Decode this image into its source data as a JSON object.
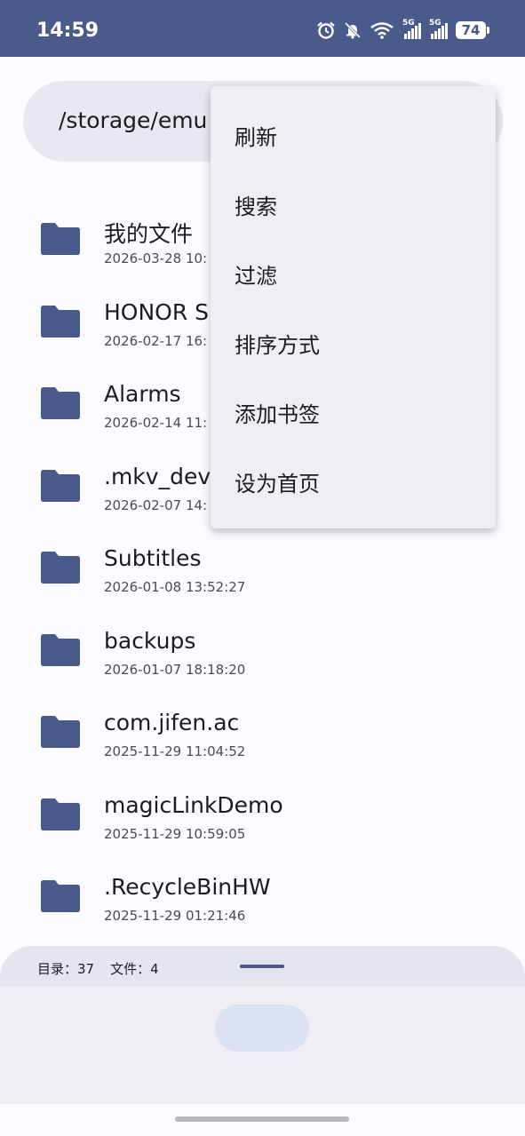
{
  "status_bar": {
    "time": "14:59",
    "signal1_label": "5G",
    "signal2_label": "5G",
    "battery": "74",
    "icons": [
      "alarm-icon",
      "bell-muted-icon",
      "wifi-icon",
      "signal-icon",
      "signal-icon",
      "battery-icon"
    ]
  },
  "path_bar": {
    "path": "/storage/emu"
  },
  "files": [
    {
      "name": " 我的文件",
      "date": "2026-03-28 10:"
    },
    {
      "name": "HONOR S",
      "date": "2026-02-17 16:"
    },
    {
      "name": "Alarms",
      "date": "2026-02-14 11:"
    },
    {
      "name": ".mkv_devi",
      "date": "2026-02-07 14:"
    },
    {
      "name": "Subtitles",
      "date": "2026-01-08 13:52:27"
    },
    {
      "name": "backups",
      "date": "2026-01-07 18:18:20"
    },
    {
      "name": "com.jifen.ac",
      "date": "2025-11-29 11:04:52"
    },
    {
      "name": "magicLinkDemo",
      "date": "2025-11-29 10:59:05"
    },
    {
      "name": ".RecycleBinHW",
      "date": "2025-11-29 01:21:46"
    }
  ],
  "menu": {
    "items": [
      "刷新",
      "搜索",
      "过滤",
      "排序方式",
      "添加书签",
      "设为首页"
    ]
  },
  "bottom_sheet": {
    "dirs_label": "目录：37",
    "files_label": "文件：4"
  },
  "colors": {
    "accent": "#4a5a8a",
    "surface": "#fcfbff",
    "menu_bg": "#efeef4"
  }
}
